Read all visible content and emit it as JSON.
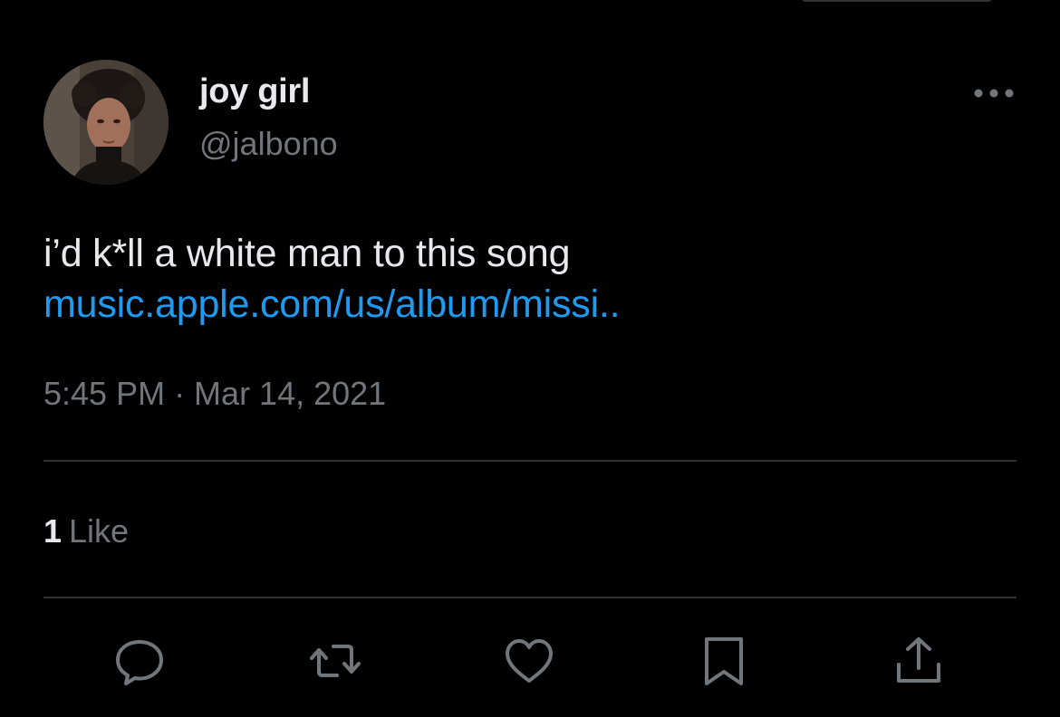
{
  "tweet": {
    "author": {
      "display_name": "joy girl",
      "handle": "@jalbono",
      "avatar_icon": "profile-photo"
    },
    "text": "i’d k*ll a white man to this song",
    "link": "music.apple.com/us/album/missi..",
    "timestamp": "5:45 PM · Mar 14, 2021",
    "likes": {
      "count": "1",
      "label": "Like"
    }
  },
  "actions": [
    {
      "name": "reply",
      "icon": "speech-bubble-icon"
    },
    {
      "name": "retweet",
      "icon": "retweet-icon"
    },
    {
      "name": "like",
      "icon": "heart-icon"
    },
    {
      "name": "bookmark",
      "icon": "bookmark-icon"
    },
    {
      "name": "share",
      "icon": "share-icon"
    }
  ],
  "colors": {
    "background": "#000000",
    "text_primary": "#e7e9ea",
    "text_secondary": "#71767b",
    "link": "#1d9bf0",
    "divider": "#2f3336"
  }
}
